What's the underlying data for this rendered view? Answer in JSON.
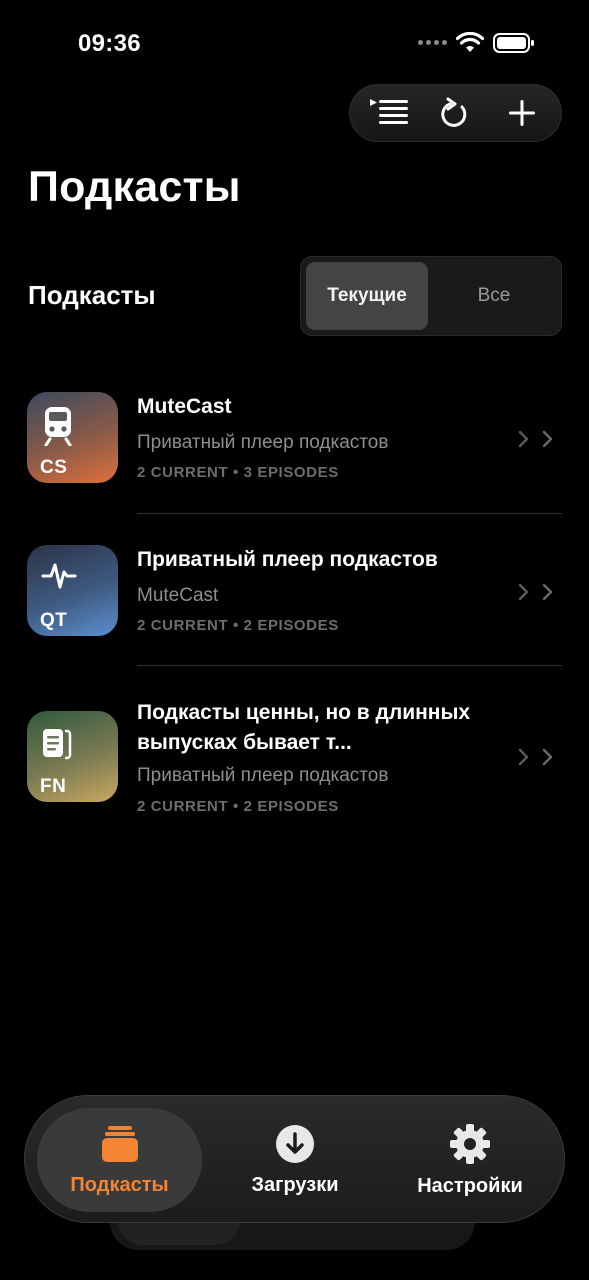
{
  "status_bar": {
    "time": "09:36"
  },
  "header": {
    "title": "Подкасты"
  },
  "section": {
    "title": "Подкасты",
    "segments": [
      "Текущие",
      "Все"
    ],
    "selected": "Текущие"
  },
  "podcasts": [
    {
      "code": "CS",
      "icon": "train-icon",
      "title": "MuteCast",
      "subtitle": "Приватный плеер подкастов",
      "meta": "2 CURRENT • 3 EPISODES",
      "colors": [
        "#3b4a5e",
        "#e0703a"
      ]
    },
    {
      "code": "QT",
      "icon": "heartbeat-icon",
      "title": "Приватный плеер подкастов",
      "subtitle": "MuteCast",
      "meta": "2 CURRENT • 2 EPISODES",
      "colors": [
        "#2b3348",
        "#5b8fd0"
      ]
    },
    {
      "code": "FN",
      "icon": "document-icon",
      "title": "Подкасты ценны, но в длинных выпусках бывает т...",
      "subtitle": "Приватный плеер подкастов",
      "meta": "2 CURRENT • 2 EPISODES",
      "colors": [
        "#2f5a3e",
        "#c9a860"
      ]
    }
  ],
  "tabbar": {
    "podcasts": "Подкасты",
    "downloads": "Загрузки",
    "settings": "Настройки"
  },
  "accent_color": "#f28433"
}
